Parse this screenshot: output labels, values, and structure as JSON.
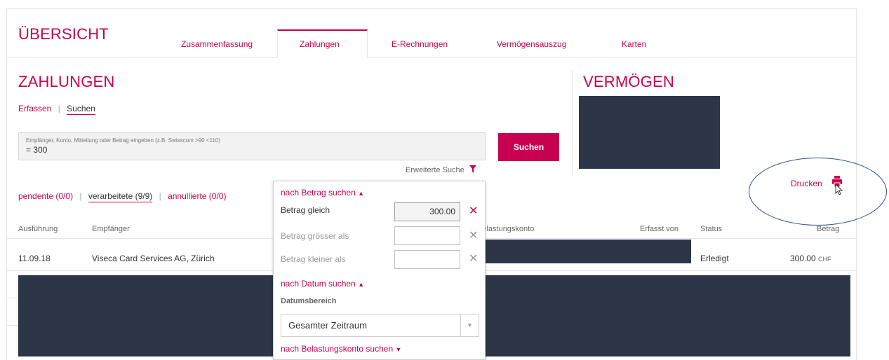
{
  "header": {
    "title": "ÜBERSICHT",
    "tabs": [
      {
        "label": "Zusammenfassung"
      },
      {
        "label": "Zahlungen"
      },
      {
        "label": "E-Rechnungen"
      },
      {
        "label": "Vermögensauszug"
      },
      {
        "label": "Karten"
      }
    ],
    "active_tab": "Zahlungen"
  },
  "zahlungen": {
    "title": "ZAHLUNGEN",
    "subnav": {
      "erfassen": "Erfassen",
      "separator": "|",
      "suchen": "Suchen"
    },
    "search": {
      "placeholder": "Empfänger, Konto, Mitteilung oder Betrag eingeben (z.B. Swisscom >90 <110)",
      "value": "= 300",
      "button": "Suchen",
      "advanced": "Erweiterte Suche"
    },
    "filters": {
      "pending": "pendente (0/0)",
      "processed": "verarbeitete (9/9)",
      "cancelled": "annullierte (0/0)",
      "separator": "|"
    },
    "columns": {
      "ausfuehrung": "Ausführung",
      "empfaenger": "Empfänger",
      "belastungskonto": "Belastungskonto",
      "erfasst_von": "Erfasst von",
      "status": "Status",
      "betrag": "Betrag"
    },
    "rows": [
      {
        "date": "11.09.18",
        "recipient": "Viseca Card Services AG, Zürich",
        "status": "Erledigt",
        "amount": "300.00",
        "currency": "CHF"
      }
    ]
  },
  "vermoegen": {
    "title": "VERMÖGEN"
  },
  "print": {
    "label": "Drucken",
    "icon": "printer-icon"
  },
  "advanced_panel": {
    "amount_section": "nach Betrag suchen",
    "amount_equal_label": "Betrag gleich",
    "amount_equal_value": "300.00",
    "amount_greater_label": "Betrag grösser als",
    "amount_less_label": "Betrag kleiner als",
    "date_section": "nach Datum suchen",
    "date_range_label": "Datumsbereich",
    "date_range_value": "Gesamter Zeitraum",
    "account_section": "nach Belastungskonto suchen"
  },
  "colors": {
    "accent": "#c8004f",
    "redaction": "#2d3648",
    "annotation": "#2c4f8a"
  }
}
